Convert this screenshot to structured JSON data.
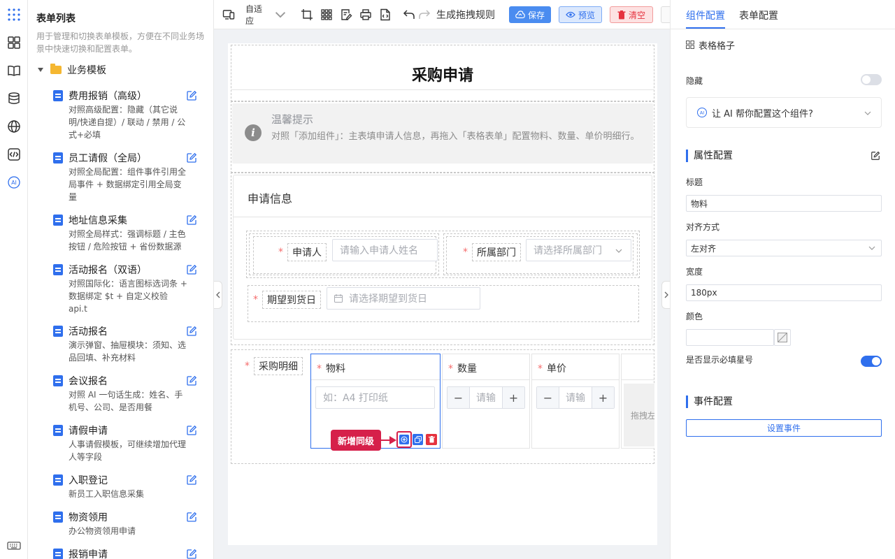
{
  "sidebar_rail": {
    "icons": [
      "apps-icon",
      "layout-icon",
      "book-icon",
      "database-icon",
      "globe-icon",
      "code-icon",
      "ai-icon",
      "keyboard-icon"
    ]
  },
  "template_panel": {
    "title": "表单列表",
    "description": "用于管理和切换表单模板，方便在不同业务场景中快速切换和配置表单。",
    "group_label": "业务模板",
    "items": [
      {
        "name": "费用报销（高级）",
        "desc": "对照高级配置：隐藏（其它说明/快递自提）/ 联动 / 禁用 / 公式+必填"
      },
      {
        "name": "员工请假（全局）",
        "desc": "对照全局配置：组件事件引用全局事件 + 数据绑定引用全局变量"
      },
      {
        "name": "地址信息采集",
        "desc": "对照全局样式：强调标题 / 主色按钮 / 危险按钮 + 省份数据源"
      },
      {
        "name": "活动报名（双语）",
        "desc": "对照国际化：语言图标选词条 + 数据绑定 $t + 自定义校验 api.t"
      },
      {
        "name": "活动报名",
        "desc": "演示弹窗、抽屉模块：须知、选品回填、补充材料"
      },
      {
        "name": "会议报名",
        "desc": "对照 AI 一句话生成：姓名、手机号、公司、是否用餐"
      },
      {
        "name": "请假申请",
        "desc": "人事请假模板，可继续增加代理人等字段"
      },
      {
        "name": "入职登记",
        "desc": "新员工入职信息采集"
      },
      {
        "name": "物资领用",
        "desc": "办公物资领用申请"
      },
      {
        "name": "报销申请",
        "desc": ""
      }
    ]
  },
  "toolbar": {
    "adaptive_label": "自适应",
    "generate_label": "生成拖拽规则",
    "save_label": "保存",
    "preview_label": "预览",
    "clear_label": "清空"
  },
  "canvas": {
    "form_title": "采购申请",
    "tip_title": "温馨提示",
    "tip_text": "对照「添加组件」：主表填申请人信息，再拖入「表格表单」配置物料、数量、单价明细行。",
    "card_title": "申请信息",
    "applicant_label": "申请人",
    "applicant_placeholder": "请输入申请人姓名",
    "dept_label": "所属部门",
    "dept_placeholder": "请选择所属部门",
    "date_label": "期望到货日",
    "date_placeholder": "请选择期望到货日",
    "detail_label": "采购明细",
    "col_material": "物料",
    "col_qty": "数量",
    "col_price": "单价",
    "material_placeholder": "如：A4 打印纸",
    "qty_placeholder": "请输",
    "price_placeholder": "请输",
    "drag_hint": "拖拽左",
    "add_sibling_tooltip": "新增同级"
  },
  "right_panel": {
    "tabs": [
      "组件配置",
      "表单配置"
    ],
    "active_tab": "组件配置",
    "component_name": "表格格子",
    "hidden_label": "隐藏",
    "hidden_value": false,
    "ai_prompt": "让 AI 帮你配置这个组件?",
    "props_title": "属性配置",
    "title_label": "标题",
    "title_value": "物料",
    "align_label": "对齐方式",
    "align_value": "左对齐",
    "width_label": "宽度",
    "width_value": "180px",
    "color_label": "颜色",
    "required_star_label": "是否显示必填星号",
    "required_star_value": true,
    "events_title": "事件配置",
    "set_event_label": "设置事件"
  },
  "colors": {
    "primary": "#2f6fed",
    "danger": "#e5323e",
    "highlight": "#d6204a"
  }
}
